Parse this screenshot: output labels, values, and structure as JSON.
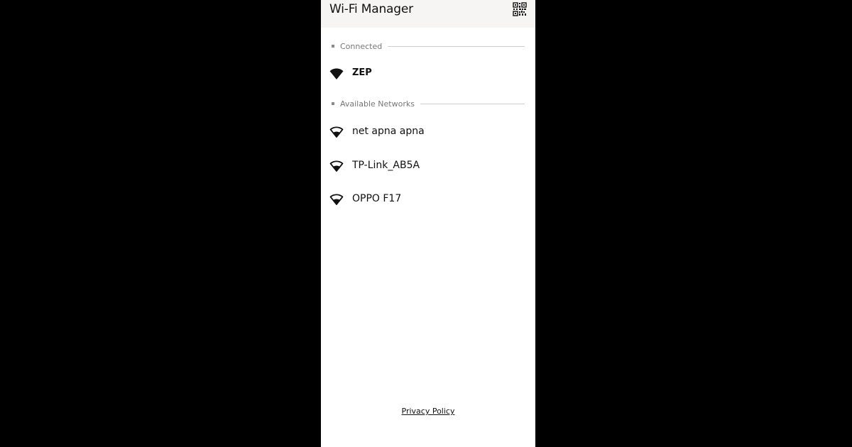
{
  "app": {
    "title": "Wi-Fi Manager",
    "qr_icon": "qr-scan-icon"
  },
  "sections": {
    "connected": {
      "label": "Connected",
      "networks": [
        {
          "name": "ZEP",
          "icon": "wifi-filled-icon"
        }
      ]
    },
    "available": {
      "label": "Available Networks",
      "networks": [
        {
          "name": "net apna apna",
          "icon": "wifi-outline-icon"
        },
        {
          "name": "TP-Link_AB5A",
          "icon": "wifi-outline-icon"
        },
        {
          "name": "OPPO F17",
          "icon": "wifi-outline-icon"
        }
      ]
    }
  },
  "footer": {
    "privacy_link": "Privacy Policy"
  },
  "colors": {
    "background": "#000000",
    "surface": "#ffffff",
    "app_bar": "#f6f5f3",
    "text": "#111111",
    "muted": "#777777"
  }
}
